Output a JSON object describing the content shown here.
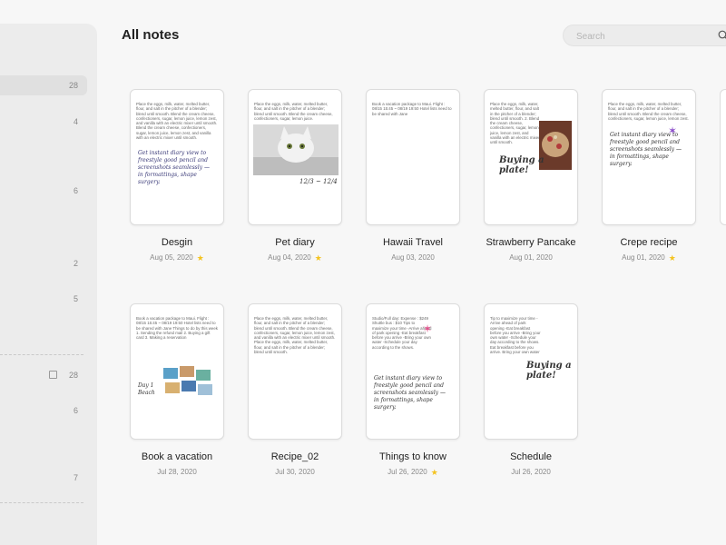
{
  "header": {
    "title": "All notes",
    "search_placeholder": "Search"
  },
  "sidebar": {
    "counts": [
      "28",
      "4",
      "6",
      "2",
      "5",
      "28",
      "6",
      "7"
    ]
  },
  "notes": [
    {
      "title": "Desgin",
      "date": "Aug 05, 2020",
      "starred": true,
      "preview": "Place the eggs, milk, water, melted butter, flour, and salt in the pitcher of a blender; blend until smooth. Blend the cream cheese, confectioners, sugar, lemon juice, lemon zest, and vanilla with an electric mixer until smooth. Blend the cream cheese, confectioners, sugar, lemon juice, lemon zest, and vanilla with an electric mixer until smooth."
    },
    {
      "title": "Pet diary",
      "date": "Aug 04, 2020",
      "starred": true,
      "preview": "Place the eggs, milk, water, melted butter, flour, and salt in the pitcher of a blender; blend until smooth. Blend the cream cheese, confectioners, sugar, lemon juice."
    },
    {
      "title": "Hawaii Travel",
      "date": "Aug 03, 2020",
      "starred": false,
      "preview": "Book a vacation package to Maui. Flight : 08/15 15:45 ~ 08/19 19:50  Hotel lists need to be shared with Jane"
    },
    {
      "title": "Strawberry Pancake",
      "date": "Aug 01, 2020",
      "starred": false,
      "preview": "Place the eggs, milk, water, melted butter, flour, and salt in the pitcher of a blender; blend until smooth. 2. Blend the cream cheese, confectioners, sugar, lemon juice, lemon zest, and vanilla with an electric mixer until smooth."
    },
    {
      "title": "Crepe recipe",
      "date": "Aug 01, 2020",
      "starred": true,
      "preview": "Place the eggs, milk, water, melted butter, flour, and salt in the pitcher of a blender; blend until smooth. Blend the cream cheese, confectioners, sugar, lemon juice, lemon zest."
    },
    {
      "title": "Book a vacation",
      "date": "Jul 28, 2020",
      "starred": false,
      "preview": "Book a vacation package to Maui. Flight : 08/15 15:45 ~ 08/19 19:50  Hotel lists need to be shared with Jane  Things to do by this week  1. Sending the refund mail 2. Buying a gift card 3. Making a reservation"
    },
    {
      "title": "Recipe_02",
      "date": "Jul 30, 2020",
      "starred": false,
      "preview": "Place the eggs, milk, water, melted butter, flour, and salt in the pitcher of a blender; blend until smooth. Blend the cream cheese, confectioners, sugar, lemon juice, lemon zest, and vanilla with an electric mixer until smooth.  Place the eggs, milk, water, melted butter, flour, and salt in the pitcher of a blender; blend until smooth."
    },
    {
      "title": "Things to know",
      "date": "Jul 26, 2020",
      "starred": true,
      "preview": "Studio/Full day: Expense : $249 Shuttle bus : $10  Tips to maximize your time  -Arrive ahead of park opening -Eat breakfast before you arrive -Bring your own water -Schedule your day according to the shows."
    },
    {
      "title": "Schedule",
      "date": "Jul 26, 2020",
      "starred": false,
      "preview": "Tip to maximize your time  -Arrive ahead of park opening -Eat breakfast before you arrive -Bring your own water -Schedule your day according to the shows.  Eat breakfast before you arrive. Bring your own water"
    }
  ],
  "handwriting": {
    "desgin": "Get instant diary view to freestyle good pencil and screenshots seamlessly — in formattings, shape surgery.",
    "pet": "12/3 ~ 12/4",
    "pancake": "Buying a plate!",
    "crepe": "Get instant diary view to freestyle good pencil and screenshots seamlessly — in formattings, shape surgery.",
    "vacation": "Day 1 Beach",
    "things": "Get instant diary view to freestyle good pencil and screenshots seamlessly — in formattings, shape surgery.",
    "schedule": "Buying a plate!"
  },
  "colors": {
    "star": "#f4c320",
    "highlight_green": "#b9efb0",
    "highlight_yellow": "#f5ea6a",
    "highlight_orange": "#f8d792"
  }
}
